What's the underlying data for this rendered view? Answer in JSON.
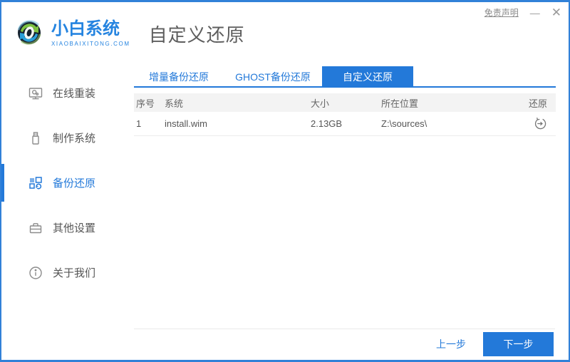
{
  "colors": {
    "accent": "#2379d9",
    "window_border": "#3181d8",
    "table_header_bg": "#f3f3f3"
  },
  "header": {
    "logo_title": "小白系统",
    "logo_subtitle": "XIAOBAIXITONG.COM",
    "page_title": "自定义还原",
    "disclaimer_label": "免责声明",
    "minimize_glyph": "—",
    "close_glyph": "✕"
  },
  "sidebar": {
    "items": [
      {
        "label": "在线重装",
        "icon": "monitor-icon",
        "active": false
      },
      {
        "label": "制作系统",
        "icon": "usb-drive-icon",
        "active": false
      },
      {
        "label": "备份还原",
        "icon": "backup-grid-icon",
        "active": true
      },
      {
        "label": "其他设置",
        "icon": "briefcase-icon",
        "active": false
      },
      {
        "label": "关于我们",
        "icon": "info-icon",
        "active": false
      }
    ]
  },
  "tabs": [
    {
      "label": "增量备份还原",
      "active": false
    },
    {
      "label": "GHOST备份还原",
      "active": false
    },
    {
      "label": "自定义还原",
      "active": true
    }
  ],
  "table": {
    "headers": [
      "序号",
      "系统",
      "大小",
      "所在位置",
      "还原"
    ],
    "rows": [
      {
        "index": "1",
        "system": "install.wim",
        "size": "2.13GB",
        "location": "Z:\\sources\\",
        "action_icon": "restore-icon"
      }
    ]
  },
  "footer": {
    "prev_label": "上一步",
    "next_label": "下一步"
  }
}
